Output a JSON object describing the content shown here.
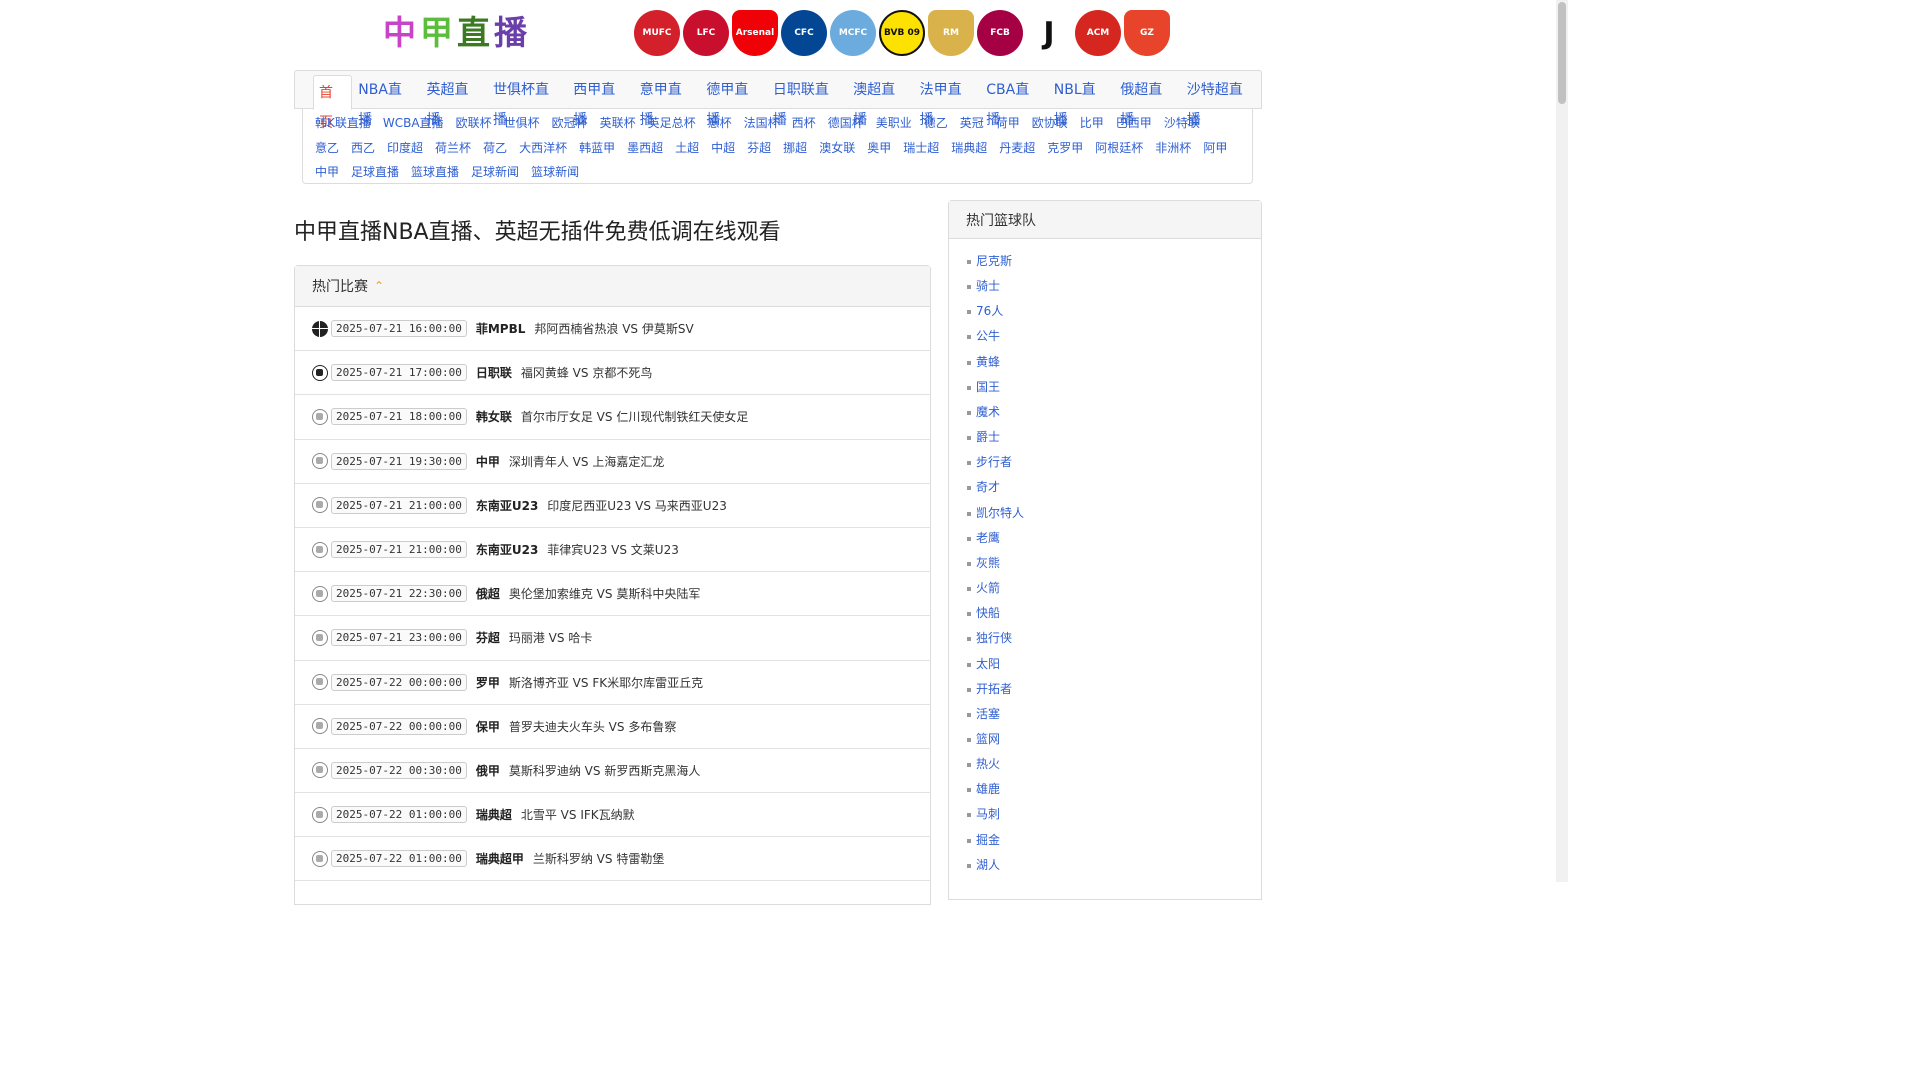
{
  "logo": {
    "chars": [
      "中",
      "甲",
      "直",
      "播"
    ]
  },
  "crests": [
    {
      "name": "manchester-united-crest",
      "label": "MUFC",
      "color": "#d4202a"
    },
    {
      "name": "liverpool-crest",
      "label": "LFC",
      "color": "#c8102e"
    },
    {
      "name": "arsenal-crest",
      "label": "Arsenal",
      "color": "#ef0107"
    },
    {
      "name": "chelsea-crest",
      "label": "CFC",
      "color": "#034694"
    },
    {
      "name": "manchester-city-crest",
      "label": "MCFC",
      "color": "#6cabdd"
    },
    {
      "name": "dortmund-crest",
      "label": "BVB 09",
      "color": "#fde100"
    },
    {
      "name": "real-madrid-crest",
      "label": "RM",
      "color": "#d9b24c"
    },
    {
      "name": "barcelona-crest",
      "label": "FCB",
      "color": "#a50044"
    },
    {
      "name": "juventus-crest",
      "label": "J",
      "color": "#111111"
    },
    {
      "name": "ac-milan-crest",
      "label": "ACM",
      "color": "#d5261f"
    },
    {
      "name": "guangzhou-crest",
      "label": "GZ",
      "color": "#e8442c"
    }
  ],
  "nav": {
    "main": [
      "首页",
      "NBA直播",
      "英超直播",
      "世俱杯直播",
      "西甲直播",
      "意甲直播",
      "德甲直播",
      "日职联直播",
      "澳超直播",
      "法甲直播",
      "CBA直播",
      "NBL直播",
      "俄超直播",
      "沙特超直播"
    ],
    "sub": [
      "韩K联直播",
      "WCBA直播",
      "欧联杯",
      "世俱杯",
      "欧冠杯",
      "英联杯",
      "英足总杯",
      "意杯",
      "法国杯",
      "西杯",
      "德国杯",
      "美职业",
      "德乙",
      "英冠",
      "荷甲",
      "欧协联",
      "比甲",
      "巴西甲",
      "沙特联",
      "意乙",
      "西乙",
      "印度超",
      "荷兰杯",
      "荷乙",
      "大西洋杯",
      "韩蓝甲",
      "墨西超",
      "土超",
      "中超",
      "芬超",
      "挪超",
      "澳女联",
      "奥甲",
      "瑞士超",
      "瑞典超",
      "丹麦超",
      "克罗甲",
      "阿根廷杯",
      "非洲杯",
      "阿甲",
      "中甲",
      "足球直播",
      "篮球直播",
      "足球新闻",
      "篮球新闻"
    ]
  },
  "page_title": "中甲直播NBA直播、英超无插件免费低调在线观看",
  "hot_matches": {
    "title": "热门比赛",
    "items": [
      {
        "sport": "basketball",
        "time": "2025-07-21 16:00:00",
        "league": "菲MPBL",
        "teams": "邦阿西楠省热浪 VS 伊莫斯SV"
      },
      {
        "sport": "soccer-dark",
        "time": "2025-07-21 17:00:00",
        "league": "日职联",
        "teams": "福冈黄蜂 VS 京都不死鸟"
      },
      {
        "sport": "soccer",
        "time": "2025-07-21 18:00:00",
        "league": "韩女联",
        "teams": "首尔市厅女足 VS 仁川现代制铁红天使女足"
      },
      {
        "sport": "soccer",
        "time": "2025-07-21 19:30:00",
        "league": "中甲",
        "teams": "深圳青年人 VS 上海嘉定汇龙"
      },
      {
        "sport": "soccer",
        "time": "2025-07-21 21:00:00",
        "league": "东南亚U23",
        "teams": "印度尼西亚U23 VS 马来西亚U23"
      },
      {
        "sport": "soccer",
        "time": "2025-07-21 21:00:00",
        "league": "东南亚U23",
        "teams": "菲律宾U23 VS 文莱U23"
      },
      {
        "sport": "soccer",
        "time": "2025-07-21 22:30:00",
        "league": "俄超",
        "teams": "奥伦堡加索维克 VS 莫斯科中央陆军"
      },
      {
        "sport": "soccer",
        "time": "2025-07-21 23:00:00",
        "league": "芬超",
        "teams": "玛丽港 VS 哈卡"
      },
      {
        "sport": "soccer",
        "time": "2025-07-22 00:00:00",
        "league": "罗甲",
        "teams": "斯洛博齐亚 VS FK米耶尔库雷亚丘克"
      },
      {
        "sport": "soccer",
        "time": "2025-07-22 00:00:00",
        "league": "保甲",
        "teams": "普罗夫迪夫火车头 VS 多布鲁察"
      },
      {
        "sport": "soccer",
        "time": "2025-07-22 00:30:00",
        "league": "俄甲",
        "teams": "莫斯科罗迪纳 VS 新罗西斯克黑海人"
      },
      {
        "sport": "soccer",
        "time": "2025-07-22 01:00:00",
        "league": "瑞典超",
        "teams": "北雪平 VS IFK瓦纳默"
      },
      {
        "sport": "soccer",
        "time": "2025-07-22 01:00:00",
        "league": "瑞典超甲",
        "teams": "兰斯科罗纳 VS 特雷勒堡"
      }
    ]
  },
  "hot_teams": {
    "title": "热门篮球队",
    "items": [
      "尼克斯",
      "骑士",
      "76人",
      "公牛",
      "黄蜂",
      "国王",
      "魔术",
      "爵士",
      "步行者",
      "奇才",
      "凯尔特人",
      "老鹰",
      "灰熊",
      "火箭",
      "快船",
      "独行侠",
      "太阳",
      "开拓者",
      "活塞",
      "篮网",
      "热火",
      "雄鹿",
      "马刺",
      "掘金",
      "湖人"
    ]
  }
}
